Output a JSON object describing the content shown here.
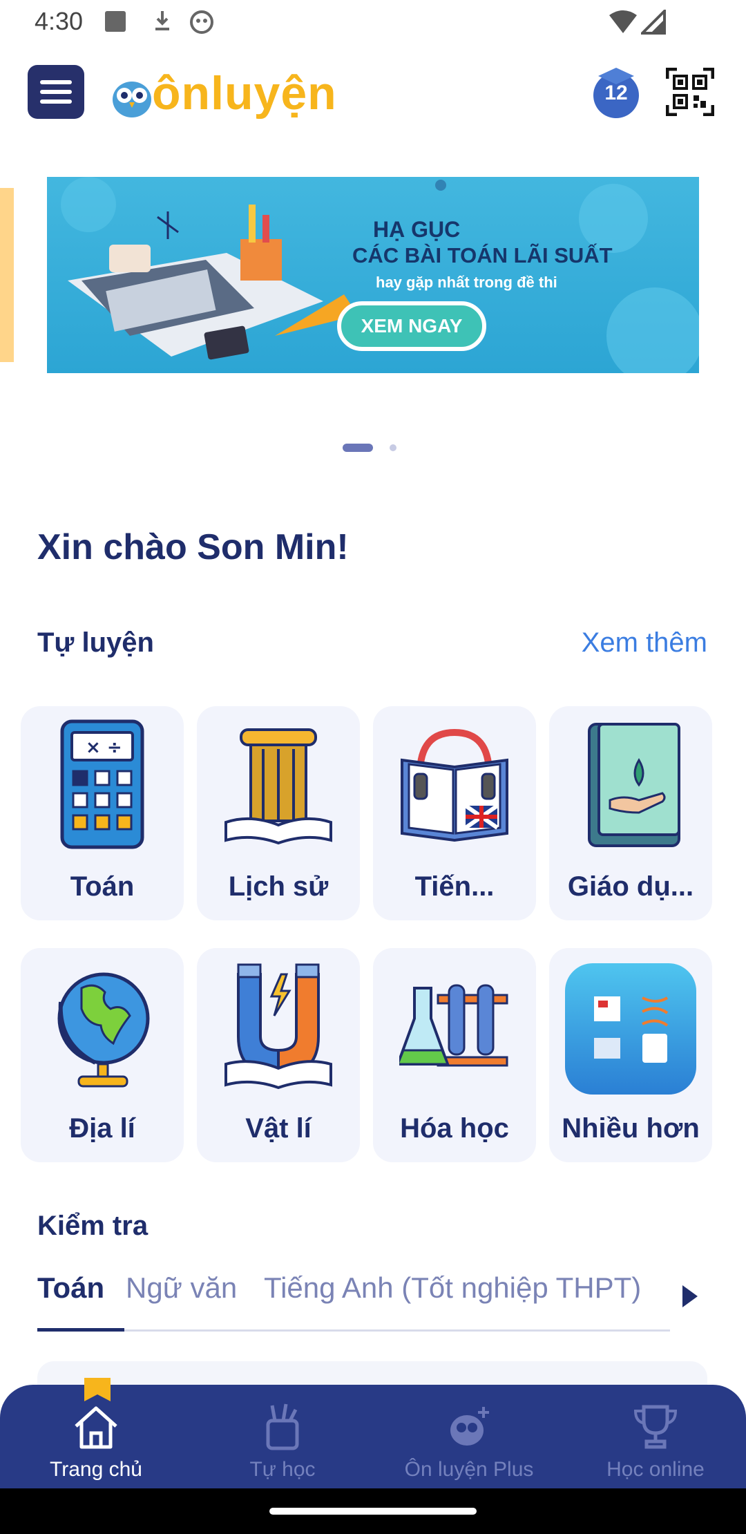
{
  "status_bar": {
    "time": "4:30"
  },
  "app_bar": {
    "logo_text": "ônluyện",
    "grade_badge": "12"
  },
  "banner": {
    "line1": "HẠ GỤC",
    "line2": "CÁC BÀI TOÁN LÃI SUẤT",
    "line3": "hay gặp nhất trong đề thi",
    "cta": "XEM NGAY"
  },
  "greeting": "Xin chào Son Min!",
  "self_study": {
    "title": "Tự luyện",
    "see_more": "Xem thêm",
    "subjects": [
      {
        "label": "Toán",
        "icon": "calculator-icon"
      },
      {
        "label": "Lịch sử",
        "icon": "column-book-icon"
      },
      {
        "label": "Tiến...",
        "icon": "english-book-headphones-icon"
      },
      {
        "label": "Giáo dụ...",
        "icon": "civics-book-icon"
      },
      {
        "label": "Địa lí",
        "icon": "globe-icon"
      },
      {
        "label": "Vật lí",
        "icon": "magnet-icon"
      },
      {
        "label": "Hóa học",
        "icon": "flask-icon"
      },
      {
        "label": "Nhiều hơn",
        "icon": "more-subjects-icon"
      }
    ]
  },
  "tests": {
    "title": "Kiểm tra",
    "tabs": [
      "Toán",
      "Ngữ  văn",
      "Tiếng Anh (Tốt nghiệp THPT)"
    ]
  },
  "bottom_nav": [
    {
      "label": "Trang chủ",
      "icon": "home-icon",
      "active": true
    },
    {
      "label": "Tự học",
      "icon": "pencil-cup-icon",
      "active": false
    },
    {
      "label": "Ôn luyện Plus",
      "icon": "owl-plus-icon",
      "active": false
    },
    {
      "label": "Học online",
      "icon": "trophy-icon",
      "active": false
    }
  ],
  "colors": {
    "primary": "#1f2d6b",
    "accent": "#3b7de1",
    "logo_yellow": "#f7b51c",
    "nav_bg": "#283a86",
    "tile_bg": "#f2f4fc"
  }
}
